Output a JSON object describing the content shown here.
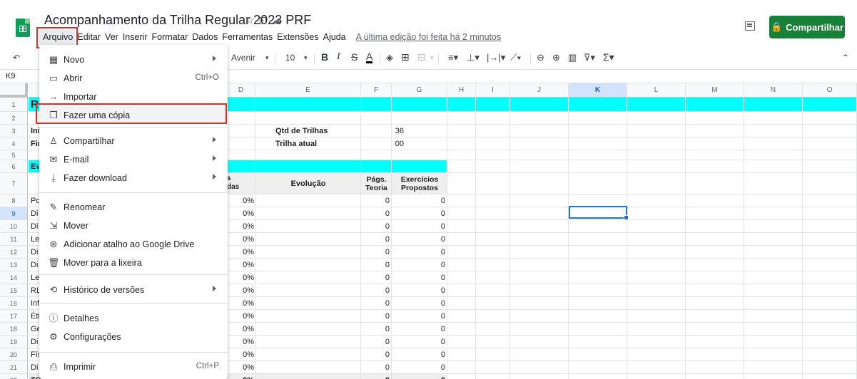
{
  "header": {
    "title": "Acompanhamento da Trilha Regular 2023 PRF",
    "share_label": "Compartilhar",
    "last_edit": "A última edição foi feita há 2 minutos"
  },
  "menubar": [
    "Arquivo",
    "Editar",
    "Ver",
    "Inserir",
    "Formatar",
    "Dados",
    "Ferramentas",
    "Extensões",
    "Ajuda"
  ],
  "toolbar": {
    "font": "Avenir",
    "font_size": "10"
  },
  "formula": {
    "cell_ref": "K9"
  },
  "columns": [
    "D",
    "E",
    "F",
    "G",
    "H",
    "I",
    "J",
    "K",
    "L",
    "M",
    "N",
    "O"
  ],
  "rows": [
    "1",
    "2",
    "3",
    "4",
    "5",
    "6",
    "7",
    "8",
    "9",
    "10",
    "11",
    "12",
    "13",
    "14",
    "15",
    "16",
    "17",
    "18",
    "19",
    "20",
    "21",
    "22"
  ],
  "sheet": {
    "row1_a": "R",
    "row3_a": "Ini",
    "row4_a": "Fir",
    "row6_a": "Ev",
    "qtd_label": "Qtd de Trilhas",
    "qtd_value": "36",
    "atual_label": "Trilha atual",
    "atual_value": "00",
    "hdr_c_1": "s",
    "hdr_c_2": "das",
    "hdr_evolucao": "Evolução",
    "hdr_pags_1": "Págs.",
    "hdr_pags_2": "Teoria",
    "hdr_exerc_1": "Exercícios",
    "hdr_exerc_2": "Propostos",
    "row_a_prefixes": [
      "Po",
      "Di",
      "Di",
      "Le",
      "Di",
      "Di",
      "Le",
      "RL",
      "Inf",
      "Éti",
      "Ge",
      "Di",
      "Fís",
      "Di",
      "TO"
    ],
    "pct": "0%",
    "zero": "0"
  },
  "menu": {
    "items": [
      {
        "label": "Novo",
        "icon": "sheets-icon",
        "shortcut": "",
        "submenu": true
      },
      {
        "label": "Abrir",
        "icon": "folder-icon",
        "shortcut": "Ctrl+O",
        "submenu": false
      },
      {
        "label": "Importar",
        "icon": "import-icon",
        "shortcut": "",
        "submenu": false
      },
      {
        "label": "Fazer uma cópia",
        "icon": "copy-icon",
        "shortcut": "",
        "submenu": false
      },
      {
        "label": "Compartilhar",
        "icon": "share-person-icon",
        "shortcut": "",
        "submenu": true
      },
      {
        "label": "E-mail",
        "icon": "email-icon",
        "shortcut": "",
        "submenu": true
      },
      {
        "label": "Fazer download",
        "icon": "download-icon",
        "shortcut": "",
        "submenu": true
      },
      {
        "label": "Renomear",
        "icon": "rename-icon",
        "shortcut": "",
        "submenu": false
      },
      {
        "label": "Mover",
        "icon": "move-icon",
        "shortcut": "",
        "submenu": false
      },
      {
        "label": "Adicionar atalho ao Google Drive",
        "icon": "drive-shortcut-icon",
        "shortcut": "",
        "submenu": false
      },
      {
        "label": "Mover para a lixeira",
        "icon": "trash-icon",
        "shortcut": "",
        "submenu": false
      },
      {
        "label": "Histórico de versões",
        "icon": "history-icon",
        "shortcut": "",
        "submenu": true
      },
      {
        "label": "Detalhes",
        "icon": "info-icon",
        "shortcut": "",
        "submenu": false
      },
      {
        "label": "Configurações",
        "icon": "gear-icon",
        "shortcut": "",
        "submenu": false
      },
      {
        "label": "Imprimir",
        "icon": "print-icon",
        "shortcut": "Ctrl+P",
        "submenu": false
      }
    ]
  },
  "colors": {
    "accent": "#188038",
    "highlight": "#d93025",
    "cyan": "#00ffff",
    "selection": "#1a73e8"
  }
}
